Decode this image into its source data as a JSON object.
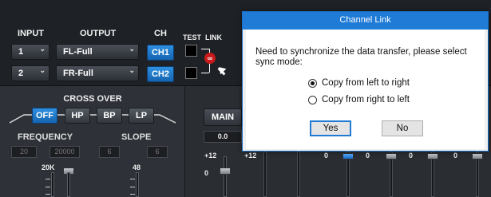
{
  "top": {
    "input_header": "INPUT",
    "output_header": "OUTPUT",
    "ch_header": "CH",
    "test_header": "TEST",
    "link_header": "LINK",
    "rows": [
      {
        "input": "1",
        "output": "FL-Full",
        "ch": "CH1"
      },
      {
        "input": "2",
        "output": "FR-Full",
        "ch": "CH2"
      }
    ],
    "link_icon": "∞",
    "caret": "⌄"
  },
  "crossover": {
    "title": "CROSS OVER",
    "filters": [
      "OFF",
      "HP",
      "BP",
      "LP"
    ],
    "active_filter": "OFF",
    "frequency_label": "FREQUENCY",
    "slope_label": "SLOPE",
    "frequency_values": [
      "20",
      "20000"
    ],
    "slope_values": [
      "6",
      "6"
    ],
    "freq_tick": "20K",
    "slope_tick": "48"
  },
  "main": {
    "tab_label": "MAIN",
    "value": "0.0",
    "tick_top": "+12",
    "tick_zero": "0",
    "tick_top_2": "+12",
    "eq_zero": "0"
  },
  "dialog": {
    "title": "Channel Link",
    "message": "Need to synchronize the data transfer, please select sync mode:",
    "options": [
      "Copy from left to right",
      "Copy from right to left"
    ],
    "selected_option": 0,
    "yes_label": "Yes",
    "no_label": "No"
  }
}
